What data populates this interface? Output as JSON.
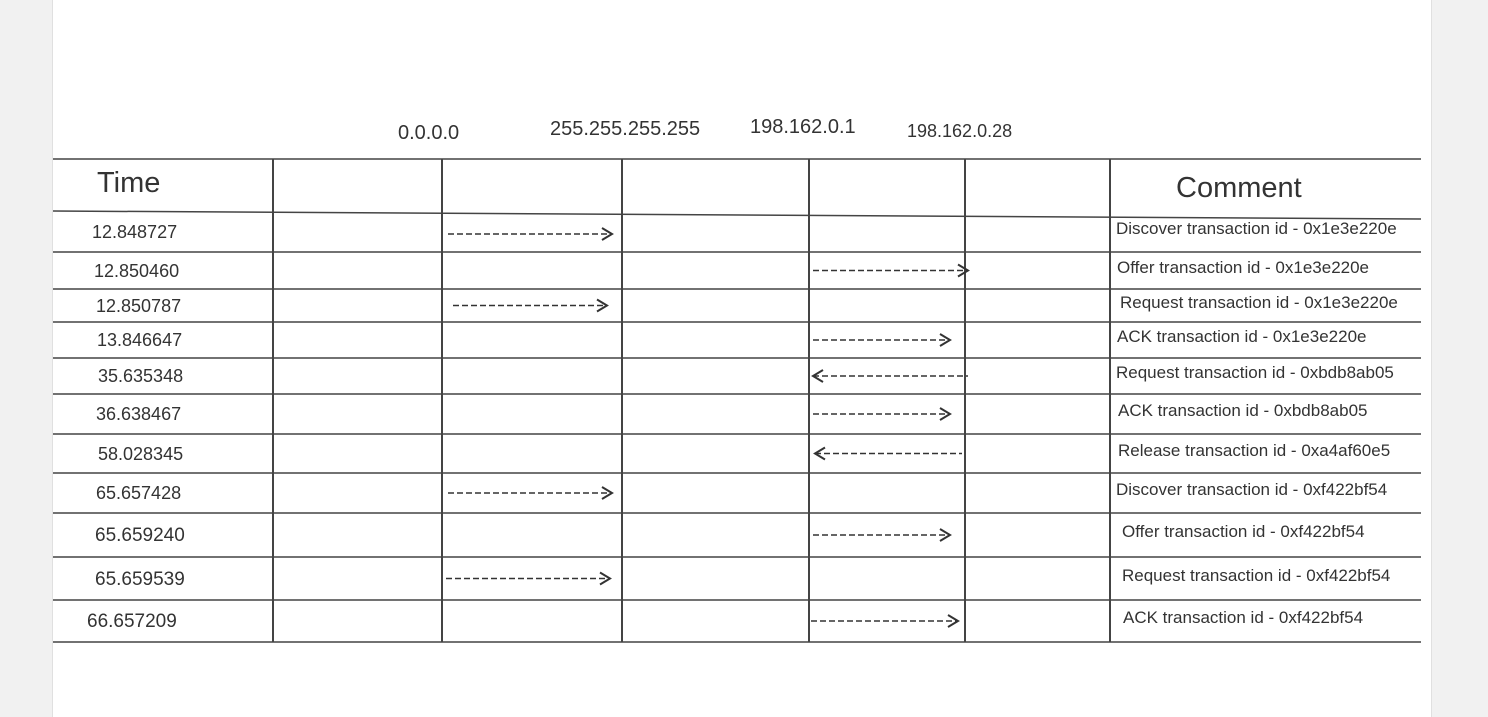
{
  "hosts": [
    "0.0.0.0",
    "255.255.255.255",
    "198.162.0.1",
    "198.162.0.28"
  ],
  "headers": {
    "time": "Time",
    "comment": "Comment"
  },
  "rows": [
    {
      "time": "12.848727",
      "comment": "Discover transaction id - 0x1e3e220e",
      "arrow": {
        "lane": "0.0.0.0-255.255.255.255",
        "direction": "right"
      }
    },
    {
      "time": "12.850460",
      "comment": "Offer transaction id - 0x1e3e220e",
      "arrow": {
        "lane": "198.162.0.1-198.162.0.28",
        "direction": "right"
      }
    },
    {
      "time": "12.850787",
      "comment": "Request transaction id - 0x1e3e220e",
      "arrow": {
        "lane": "0.0.0.0-255.255.255.255",
        "direction": "right"
      }
    },
    {
      "time": "13.846647",
      "comment": "ACK transaction id - 0x1e3e220e",
      "arrow": {
        "lane": "198.162.0.1-198.162.0.28",
        "direction": "right"
      }
    },
    {
      "time": "35.635348",
      "comment": "Request transaction id - 0xbdb8ab05",
      "arrow": {
        "lane": "198.162.0.1-198.162.0.28",
        "direction": "left"
      }
    },
    {
      "time": "36.638467",
      "comment": "ACK transaction id - 0xbdb8ab05",
      "arrow": {
        "lane": "198.162.0.1-198.162.0.28",
        "direction": "right"
      }
    },
    {
      "time": "58.028345",
      "comment": "Release transaction id - 0xa4af60e5",
      "arrow": {
        "lane": "198.162.0.1-198.162.0.28",
        "direction": "left"
      }
    },
    {
      "time": "65.657428",
      "comment": "Discover transaction id - 0xf422bf54",
      "arrow": {
        "lane": "0.0.0.0-255.255.255.255",
        "direction": "right"
      }
    },
    {
      "time": "65.659240",
      "comment": "Offer transaction id - 0xf422bf54",
      "arrow": {
        "lane": "198.162.0.1-198.162.0.28",
        "direction": "right"
      }
    },
    {
      "time": "65.659539",
      "comment": "Request transaction id - 0xf422bf54",
      "arrow": {
        "lane": "0.0.0.0-255.255.255.255",
        "direction": "right"
      }
    },
    {
      "time": "66.657209",
      "comment": "ACK transaction id - 0xf422bf54",
      "arrow": {
        "lane": "198.162.0.1-198.162.0.28",
        "direction": "right"
      }
    }
  ],
  "colors": {
    "line": "#444444",
    "text": "#333333",
    "page": "#ffffff"
  }
}
